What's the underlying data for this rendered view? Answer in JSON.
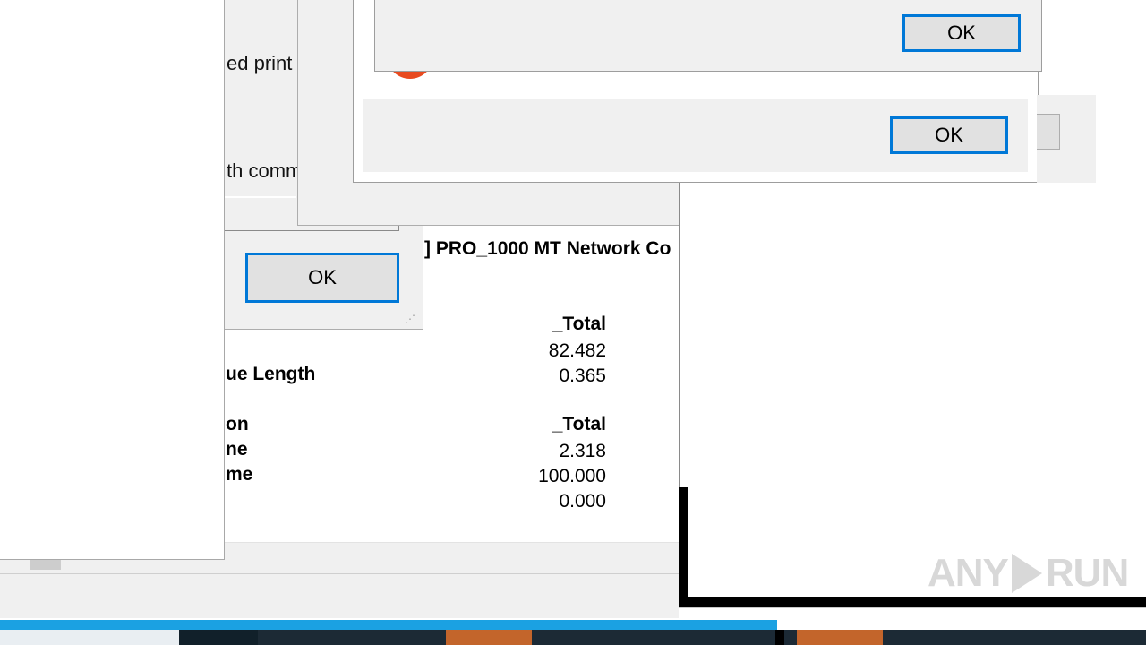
{
  "left_dialog": {
    "text_line1": "ed print",
    "text_line2": "th comm",
    "ok_label": "OK"
  },
  "front_dialog": {
    "ok_label": "OK"
  },
  "top_dialog": {
    "ok_label": "OK"
  },
  "perf": {
    "adapter_label": "] PRO_1000 MT Network Co",
    "section1": {
      "header": "_Total",
      "rows": [
        {
          "label": "",
          "value": "82.482"
        },
        {
          "label": "ue Length",
          "value": "0.365"
        }
      ]
    },
    "section2": {
      "header_label": "on",
      "header": "_Total",
      "rows": [
        {
          "label": "ne",
          "value": "2.318"
        },
        {
          "label": "me",
          "value": "100.000"
        },
        {
          "label": "",
          "value": "0.000"
        }
      ]
    }
  },
  "watermark": {
    "left": "ANY",
    "right": "RUN"
  },
  "colors": {
    "accent": "#0078d7",
    "progress": "#1ba1e2",
    "taskbar": "#1c2a35",
    "taskbar_app": "#c3652b",
    "error_icon": "#e84a1f"
  }
}
